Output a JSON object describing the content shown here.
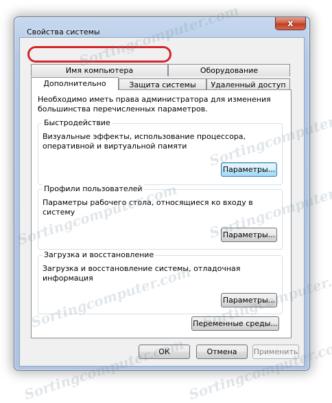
{
  "window": {
    "title": "Свойства системы",
    "close_glyph": "x"
  },
  "tabs_top": [
    {
      "label": "Имя компьютера"
    },
    {
      "label": "Оборудование"
    }
  ],
  "tabs_bottom": [
    {
      "label": "Дополнительно"
    },
    {
      "label": "Защита системы"
    },
    {
      "label": "Удаленный доступ"
    }
  ],
  "panel": {
    "intro": "Необходимо иметь права администратора для изменения большинства перечисленных параметров.",
    "performance": {
      "title": "Быстродействие",
      "text": "Визуальные эффекты, использование процессора, оперативной и виртуальной памяти",
      "button": "Параметры..."
    },
    "profiles": {
      "title": "Профили пользователей",
      "text": "Параметры рабочего стола, относящиеся ко входу в систему",
      "button": "Параметры..."
    },
    "startup": {
      "title": "Загрузка и восстановление",
      "text": "Загрузка и восстановление системы, отладочная информация",
      "button": "Параметры..."
    },
    "env_button": "Переменные среды..."
  },
  "footer": {
    "ok": "ОК",
    "cancel": "Отмена",
    "apply": "Применить"
  },
  "watermark": "Sortingcomputer.com",
  "colors": {
    "highlight": "#d2262b",
    "close_button": "#c13b1f",
    "frame": "#b3c9e6"
  }
}
